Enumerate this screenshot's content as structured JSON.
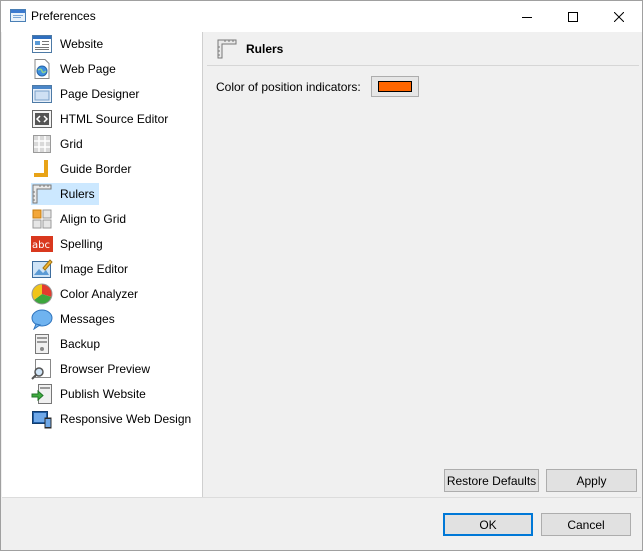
{
  "window": {
    "title": "Preferences",
    "app_icon": "preferences-window-icon",
    "controls": [
      "minimize",
      "maximize",
      "close"
    ]
  },
  "sidebar": {
    "selected_index": 6,
    "items": [
      {
        "label": "Website",
        "icon": "website-icon"
      },
      {
        "label": "Web Page",
        "icon": "web-page-icon"
      },
      {
        "label": "Page Designer",
        "icon": "page-designer-icon"
      },
      {
        "label": "HTML Source Editor",
        "icon": "html-source-icon"
      },
      {
        "label": "Grid",
        "icon": "grid-icon"
      },
      {
        "label": "Guide Border",
        "icon": "guide-border-icon"
      },
      {
        "label": "Rulers",
        "icon": "rulers-icon"
      },
      {
        "label": "Align to Grid",
        "icon": "align-to-grid-icon"
      },
      {
        "label": "Spelling",
        "icon": "spelling-icon"
      },
      {
        "label": "Image Editor",
        "icon": "image-editor-icon"
      },
      {
        "label": "Color Analyzer",
        "icon": "color-analyzer-icon"
      },
      {
        "label": "Messages",
        "icon": "messages-icon"
      },
      {
        "label": "Backup",
        "icon": "backup-icon"
      },
      {
        "label": "Browser Preview",
        "icon": "browser-preview-icon"
      },
      {
        "label": "Publish Website",
        "icon": "publish-website-icon"
      },
      {
        "label": "Responsive Web Design",
        "icon": "responsive-design-icon"
      }
    ]
  },
  "panel": {
    "title": "Rulers",
    "icon": "rulers-icon",
    "color_label": "Color of position indicators:",
    "color_value": "#ff6600",
    "restore_label": "Restore Defaults",
    "apply_label": "Apply"
  },
  "footer": {
    "ok_label": "OK",
    "cancel_label": "Cancel"
  },
  "colors": {
    "selection": "#cce8ff",
    "default_button_border": "#0078d7",
    "indicator": "#ff6600"
  }
}
